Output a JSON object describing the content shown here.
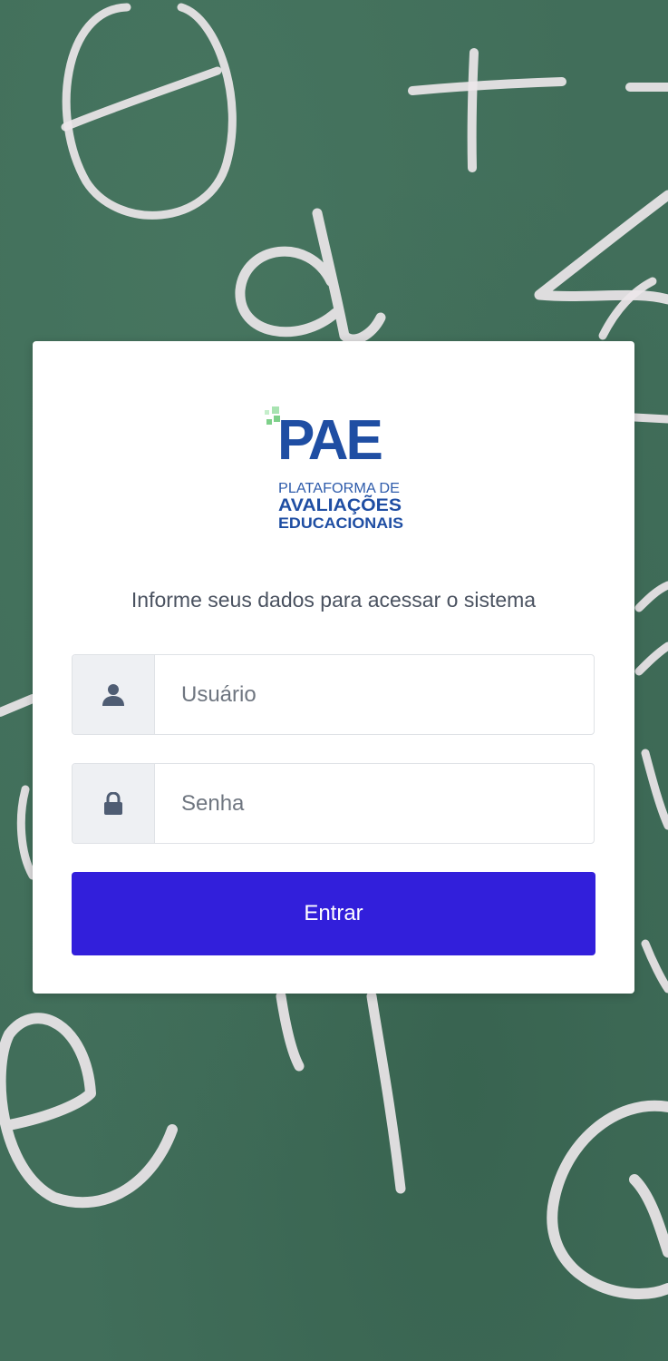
{
  "login": {
    "logo_text": "PAE",
    "logo_subtitle_1": "PLATAFORMA DE",
    "logo_subtitle_2": "AVALIAÇÕES",
    "logo_subtitle_3": "EDUCACIONAIS",
    "prompt": "Informe seus dados para acessar o sistema",
    "username": {
      "value": "",
      "placeholder": "Usuário",
      "icon": "user-icon"
    },
    "password": {
      "value": "",
      "placeholder": "Senha",
      "icon": "lock-icon"
    },
    "submit_label": "Entrar"
  },
  "colors": {
    "background": "#416e5a",
    "card": "#ffffff",
    "primary": "#321fdb",
    "logo_blue": "#1f4ea3",
    "logo_green": "#7ed08a"
  }
}
